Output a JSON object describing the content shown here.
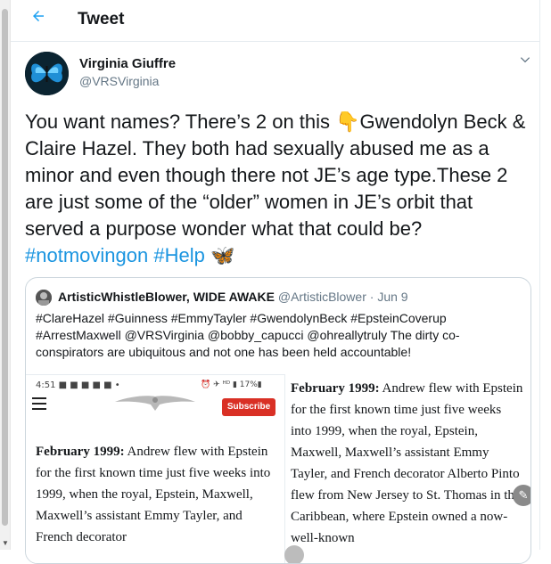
{
  "header": {
    "title": "Tweet"
  },
  "tweet": {
    "author_name": "Virginia Giuffre",
    "author_handle": "@VRSVirginia",
    "text_part1": "You want names? There’s 2 on this 👇Gwendolyn Beck & Claire Hazel. They both had sexually abused me as a minor and even though there not JE’s age type.These 2 are just some of the “older” women in JE’s orbit that served a purpose wonder what that could be?",
    "hashtag1": "#notmovingon",
    "hashtag2": "#Help",
    "emoji": "🦋"
  },
  "quoted": {
    "name": "ArtisticWhistleBlower, WIDE AWAKE",
    "handle": "@ArtisticBlower",
    "separator": "·",
    "date": "Jun 9",
    "text": "#ClareHazel #Guinness #EmmyTayler #GwendolynBeck  #EpsteinCoverup #ArrestMaxwell @VRSVirginia @bobby_capucci @ohreallytruly The dirty co-conspirators are ubiquitous and not one has been held accountable!",
    "image1": {
      "status_time": "4:51",
      "status_icons": "■ ■ ■ ■ ■  •",
      "status_right": "⏰ ✈ ᴴᴰ ▮ 17%▮",
      "subscribe": "Subscribe",
      "bold_lead": "February 1999:",
      "text": " Andrew flew with Epstein for the first known time just five weeks into 1999, when the royal, Epstein, Maxwell, Maxwell’s assistant Emmy Tayler, and French decorator"
    },
    "image2": {
      "bold_lead": "February 1999:",
      "text": " Andrew flew with Epstein for the first known time just five weeks into 1999, when the royal, Epstein, Maxwell, Maxwell’s assistant Emmy Tayler, and French decorator Alberto Pinto flew from New Jersey to St. Thomas in the Caribbean, where Epstein owned a now-well-known"
    }
  },
  "icons": {
    "back": "arrow-left-icon",
    "caret": "chevron-down-icon",
    "edit": "pencil-icon"
  },
  "colors": {
    "accent": "#1da1f2",
    "hashtag": "#1b95e0",
    "subscribe": "#d93025"
  }
}
